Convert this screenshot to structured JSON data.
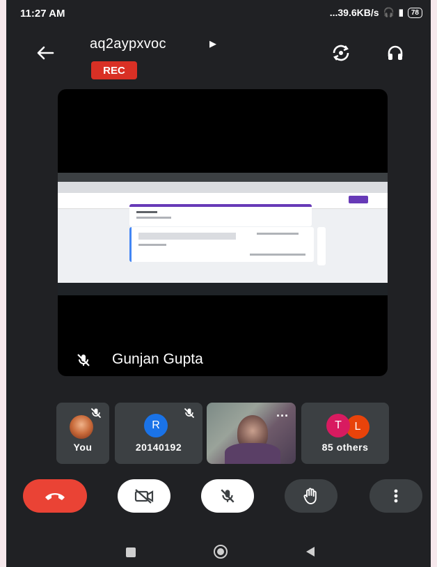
{
  "status_bar": {
    "time": "11:27 AM",
    "network_speed": "...39.6KB/s",
    "signal": "4G",
    "battery": "78"
  },
  "header": {
    "meeting_code": "aq2aypxvoc",
    "rec_label": "REC",
    "icons": [
      "back-arrow-icon",
      "switch-camera-icon",
      "headphones-icon"
    ]
  },
  "main_tile": {
    "presenter_name": "Gunjan Gupta",
    "mic_state": "muted"
  },
  "participants": [
    {
      "label": "You",
      "mic": "muted",
      "avatar": "photo"
    },
    {
      "label": "20140192",
      "mic": "muted",
      "avatar_initial": "R",
      "avatar_color": "#1a73e8"
    },
    {
      "label": "",
      "type": "video",
      "more": "..."
    },
    {
      "label": "85 others",
      "avatar_initials": [
        "T",
        "L"
      ],
      "avatar_colors": [
        "#d81b60",
        "#e8430a"
      ]
    }
  ],
  "controls": {
    "end_call_color": "#ea4335",
    "buttons": [
      "end-call",
      "camera-off",
      "mic-off",
      "raise-hand",
      "more-options"
    ]
  },
  "colors": {
    "background": "#202124",
    "tile": "#3c4043",
    "rec": "#d93025"
  }
}
